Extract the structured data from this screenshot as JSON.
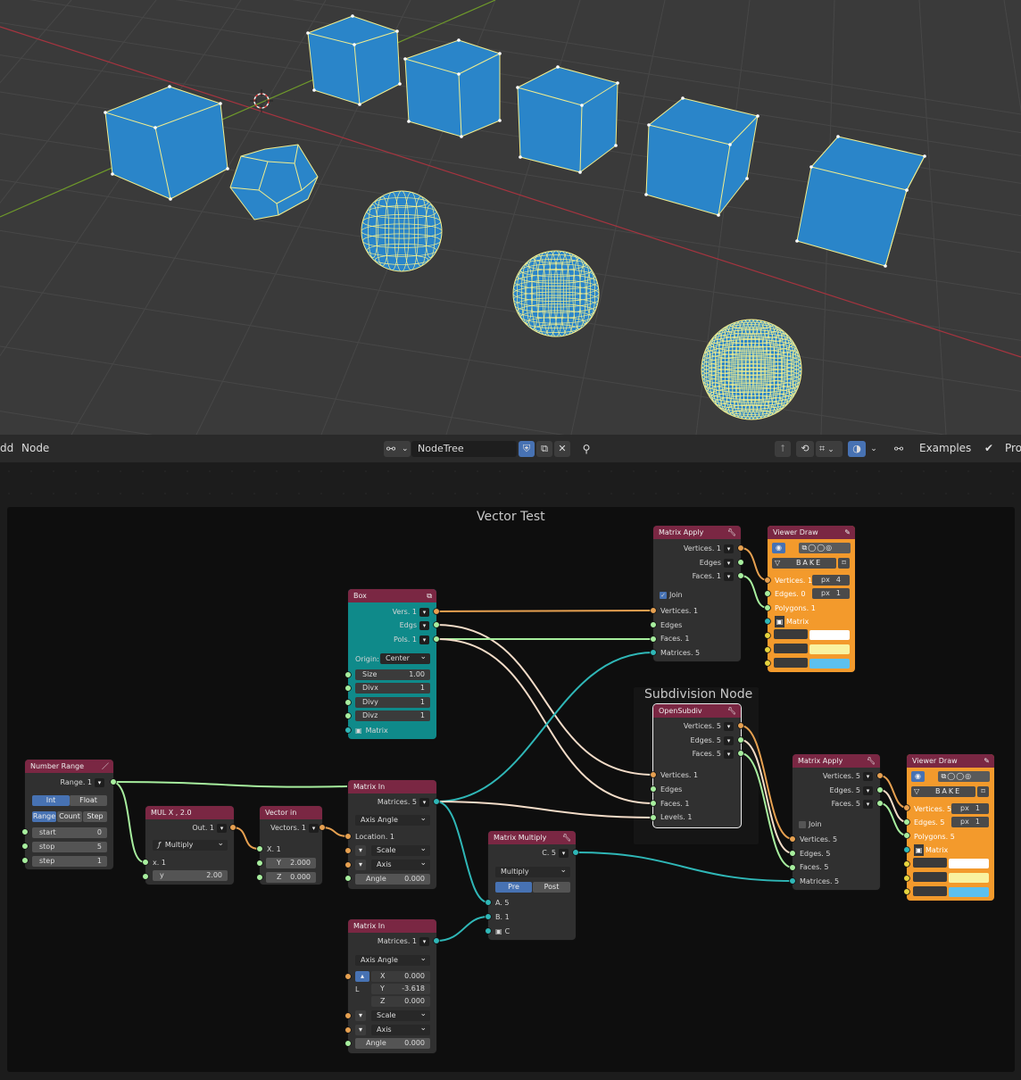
{
  "header": {
    "menu_add": "Add",
    "menu_node": "Node",
    "tree_name": "NodeTree",
    "workspace": "Examples",
    "proc_label": "Pro"
  },
  "frames": {
    "main_label": "Vector Test",
    "sub_label": "Subdivision Node"
  },
  "nodes": {
    "number_range": {
      "title": "Number Range",
      "out": "Range. 1",
      "mode_int": "Int",
      "mode_float": "Float",
      "tab_range": "Range",
      "tab_count": "Count",
      "tab_step": "Step",
      "start_label": "start",
      "start_val": "0",
      "stop_label": "stop",
      "stop_val": "5",
      "step_label": "step",
      "step_val": "1"
    },
    "mul": {
      "title": "MUL X , 2.0",
      "out": "Out. 1",
      "op": "Multiply",
      "in_x": "x. 1",
      "y_label": "y",
      "y_val": "2.00"
    },
    "vector_in": {
      "title": "Vector in",
      "out": "Vectors. 1",
      "x": "X. 1",
      "y_label": "Y",
      "y_val": "2.000",
      "z_label": "Z",
      "z_val": "0.000"
    },
    "box": {
      "title": "Box",
      "vers": "Vers. 1",
      "edgs": "Edgs",
      "pols": "Pols. 1",
      "origin_label": "Origin:",
      "origin_val": "Center",
      "size_label": "Size",
      "size_val": "1.00",
      "divx_label": "Divx",
      "divx_val": "1",
      "divy_label": "Divy",
      "divy_val": "1",
      "divz_label": "Divz",
      "divz_val": "1",
      "matrix": "Matrix"
    },
    "matrix_in1": {
      "title": "Matrix In",
      "out": "Matrices. 5",
      "mode": "Axis Angle",
      "location": "Location. 1",
      "scale": "Scale",
      "axis": "Axis",
      "angle_label": "Angle",
      "angle_val": "0.000"
    },
    "matrix_in2": {
      "title": "Matrix In",
      "out": "Matrices. 1",
      "mode": "Axis Angle",
      "x_label": "X",
      "x_val": "0.000",
      "y_label": "Y",
      "y_val": "-3.618",
      "z_label": "Z",
      "z_val": "0.000",
      "l_label": "L",
      "scale": "Scale",
      "axis": "Axis",
      "angle_label": "Angle",
      "angle_val": "0.000"
    },
    "matrix_multiply": {
      "title": "Matrix Multiply",
      "out": "C. 5",
      "op": "Multiply",
      "pre": "Pre",
      "post": "Post",
      "a": "A. 5",
      "b": "B. 1",
      "c": "C"
    },
    "matrix_apply1": {
      "title": "Matrix Apply",
      "out_vertices": "Vertices. 1",
      "out_edges": "Edges",
      "out_faces": "Faces. 1",
      "join": "Join",
      "in_vertices": "Vertices. 1",
      "in_edges": "Edges",
      "in_faces": "Faces. 1",
      "in_matrices": "Matrices. 5"
    },
    "opensubdiv": {
      "title": "OpenSubdiv",
      "out_vertices": "Vertices. 5",
      "out_edges": "Edges. 5",
      "out_faces": "Faces. 5",
      "in_vertices": "Vertices. 1",
      "in_edges": "Edges",
      "in_faces": "Faces. 1",
      "in_levels": "Levels. 1"
    },
    "matrix_apply2": {
      "title": "Matrix Apply",
      "out_vertices": "Vertices. 5",
      "out_edges": "Edges. 5",
      "out_faces": "Faces. 5",
      "join": "Join",
      "in_vertices": "Vertices. 5",
      "in_edges": "Edges. 5",
      "in_faces": "Faces. 5",
      "in_matrices": "Matrices. 5"
    },
    "viewer1": {
      "title": "Viewer Draw",
      "bake": "BAKE",
      "px1_label": "px",
      "px1_val": "4",
      "px2_label": "px",
      "px2_val": "1",
      "vertices": "Vertices. 1",
      "edges": "Edges. 0",
      "polygons": "Polygons. 1",
      "matrix": "Matrix"
    },
    "viewer2": {
      "title": "Viewer Draw",
      "bake": "BAKE",
      "px1_label": "px",
      "px1_val": "1",
      "px2_label": "px",
      "px2_val": "1",
      "vertices": "Vertices. 5",
      "edges": "Edges. 5",
      "polygons": "Polygons. 5",
      "matrix": "Matrix"
    }
  },
  "colors": {
    "viewport_bg": "#3a3a3a",
    "mesh_blue": "#2a85c9",
    "edge_yellow": "#f2ee8e",
    "header_maroon": "#7a2743",
    "box_teal": "#0f8a8a",
    "viewer_orange": "#f39a2c",
    "link_teal": "#2fb7b7",
    "link_green": "#a7ee9e",
    "link_orange": "#e6a050",
    "link_cream": "#f3dcc8",
    "swatch_white": "#ffffff",
    "swatch_yellow": "#f9f2a0",
    "swatch_blue": "#5cc0ef"
  },
  "icons": [
    "cursor-icon",
    "node-tree-icon",
    "shield-icon",
    "copy-icon",
    "close-icon",
    "pin-icon",
    "parent-icon",
    "snap-icon",
    "grid-icon",
    "overlay-icon",
    "sverchok-icon",
    "checkmark-icon",
    "eye-icon",
    "pencil-icon",
    "cube-icon",
    "wrench-icon",
    "bake-icon"
  ]
}
